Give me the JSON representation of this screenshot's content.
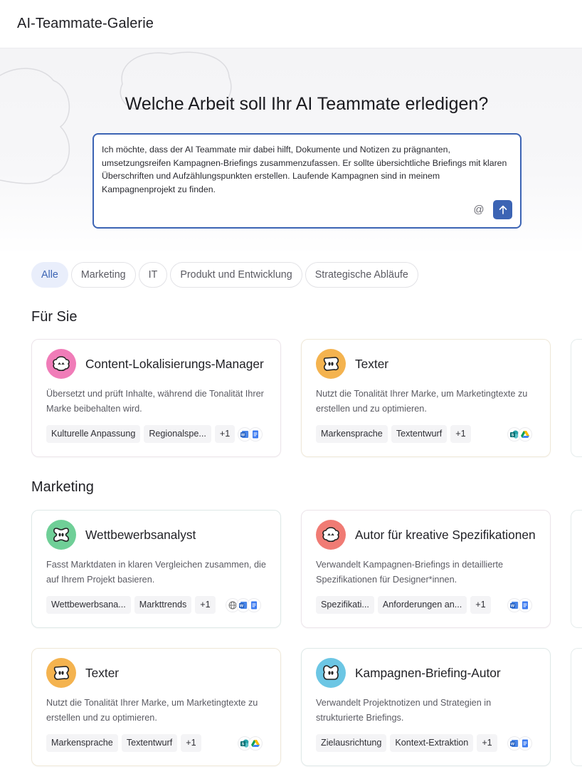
{
  "app": {
    "title": "AI-Teammate-Galerie"
  },
  "hero": {
    "heading": "Welche Arbeit soll Ihr AI Teammate erledigen?",
    "prompt_text": "Ich möchte, dass der AI Teammate mir dabei hilft, Dokumente und Notizen zu prägnanten, umsetzungsreifen Kampagnen-Briefings zusammenzufassen. Er sollte übersichtliche Briefings mit klaren Überschriften und Aufzählungspunkten erstellen. Laufende Kampagnen sind in meinem Kampagnenprojekt zu finden.",
    "mention_symbol": "@",
    "send_icon": "arrow-up-icon",
    "accent": "#3c64b4"
  },
  "filters": [
    {
      "label": "Alle",
      "active": true
    },
    {
      "label": "Marketing",
      "active": false
    },
    {
      "label": "IT",
      "active": false
    },
    {
      "label": "Produkt und Entwicklung",
      "active": false
    },
    {
      "label": "Strategische Abläufe",
      "active": false
    }
  ],
  "sections": {
    "for_you": {
      "title": "Für Sie"
    },
    "marketing": {
      "title": "Marketing"
    }
  },
  "cards": {
    "c1": {
      "title": "Content-Lokalisierungs-Manager",
      "desc": "Übersetzt und prüft Inhalte, während die Tonalität Ihrer Marke beibehalten wird.",
      "tags": [
        "Kulturelle Anpassung",
        "Regionalspe...",
        "+1"
      ],
      "avatar_color": "#f07cb8",
      "apps": [
        "word-icon",
        "docs-icon"
      ]
    },
    "c2": {
      "title": "Texter",
      "desc": "Nutzt die Tonalität Ihrer Marke, um Marketingtexte zu erstellen und zu optimieren.",
      "tags": [
        "Markensprache",
        "Textentwurf",
        "+1"
      ],
      "avatar_color": "#f4b34f",
      "apps": [
        "sharepoint-icon",
        "drive-icon"
      ]
    },
    "c3": {
      "title": "Wettbewerbsanalyst",
      "desc": "Fasst Marktdaten in klaren Vergleichen zusammen, die auf Ihrem Projekt basieren.",
      "tags": [
        "Wettbewerbsana...",
        "Markttrends",
        "+1"
      ],
      "avatar_color": "#6fcf97",
      "apps": [
        "globe-icon",
        "word-icon",
        "docs-icon"
      ]
    },
    "c4": {
      "title": "Autor für kreative Spezifikationen",
      "desc": "Verwandelt Kampagnen-Briefings in detaillierte Spezifikationen für Designer*innen.",
      "tags": [
        "Spezifikati...",
        "Anforderungen an...",
        "+1"
      ],
      "avatar_color": "#f07b74",
      "apps": [
        "word-icon",
        "docs-icon"
      ]
    },
    "c5": {
      "title": "Texter",
      "desc": "Nutzt die Tonalität Ihrer Marke, um Marketingtexte zu erstellen und zu optimieren.",
      "tags": [
        "Markensprache",
        "Textentwurf",
        "+1"
      ],
      "avatar_color": "#f4b34f",
      "apps": [
        "sharepoint-icon",
        "drive-icon"
      ]
    },
    "c6": {
      "title": "Kampagnen-Briefing-Autor",
      "desc": "Verwandelt Projektnotizen und Strategien in strukturierte Briefings.",
      "tags": [
        "Zielausrichtung",
        "Kontext-Extraktion",
        "+1"
      ],
      "avatar_color": "#6cc6e4",
      "apps": [
        "word-icon",
        "docs-icon"
      ]
    }
  }
}
